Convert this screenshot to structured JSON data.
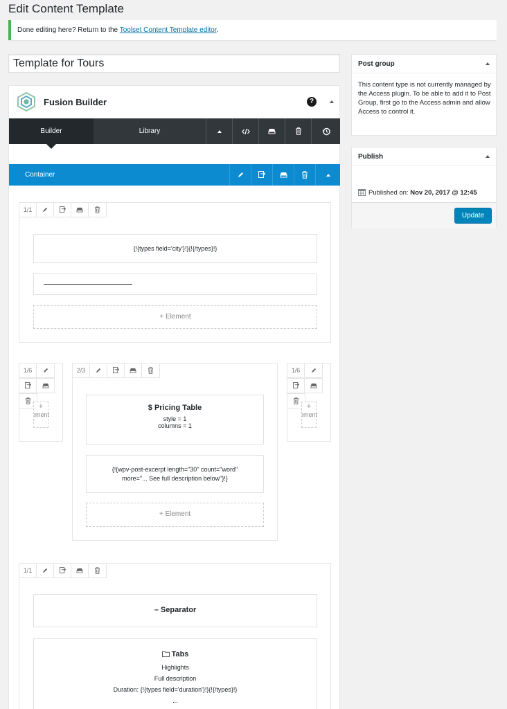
{
  "page": {
    "title": "Edit Content Template"
  },
  "notice": {
    "text": "Done editing here? Return to the ",
    "link": "Toolset Content Template editor",
    "suffix": "."
  },
  "title_input": {
    "value": "Template for Tours"
  },
  "fusion": {
    "title": "Fusion Builder",
    "help": "?",
    "tabs": {
      "builder": "Builder",
      "library": "Library"
    },
    "container_label": "Container"
  },
  "rows": {
    "row1": {
      "size": "1/1",
      "element1": "{!{types field='city'}!}{!{/types}!}",
      "add_label": "Element"
    },
    "row2": {
      "left": {
        "size": "1/6",
        "add_label": "Element"
      },
      "center": {
        "size": "2/3",
        "pricing_title": "Pricing Table",
        "pricing_line1": "style = 1",
        "pricing_line2": "columns = 1",
        "excerpt_line1": "{!{wpv-post-excerpt length=\"30\" count=\"word\"",
        "excerpt_line2": "more=\"... See full description below\"}!}",
        "add_label": "Element"
      },
      "right": {
        "size": "1/6",
        "add_label": "Element"
      }
    },
    "row3": {
      "size": "1/1",
      "separator_title": "Separator",
      "tabs_title": "Tabs",
      "tab1": "Highlights",
      "tab2": "Full description",
      "tab3": "Duration: {!{types field='duration'}!}{!{/types}!}",
      "more": "..."
    }
  },
  "sidebar": {
    "post_group": {
      "title": "Post group",
      "text": "This content type is not currently managed by the Access plugin. To be able to add it to Post Group, first go to the Access admin and allow Access to control it."
    },
    "publish": {
      "title": "Publish",
      "published_label": "Published on:",
      "published_date": "Nov 20, 2017 @ 12:45",
      "update_label": "Update"
    }
  },
  "colors": {
    "accent": "#0c8bd0",
    "toolbar": "#32373c",
    "notice": "#46b450",
    "update": "#0085ba"
  }
}
